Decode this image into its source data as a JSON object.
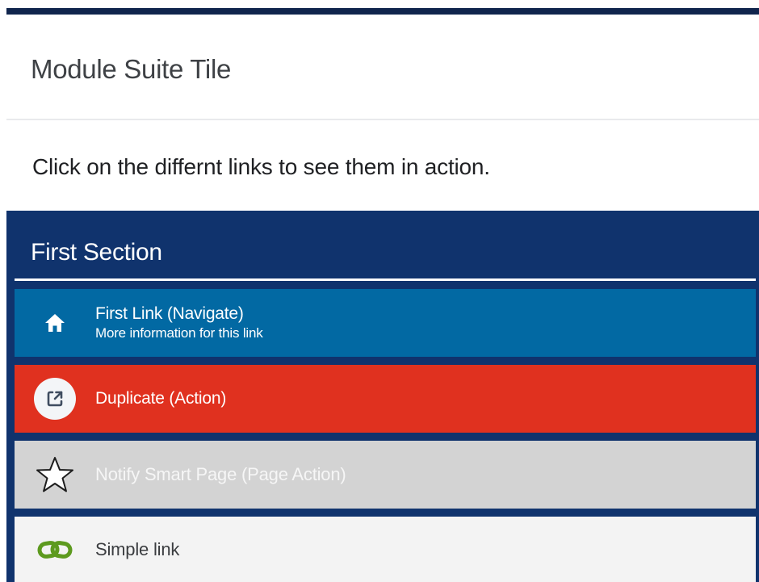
{
  "header": {
    "title": "Module Suite Tile"
  },
  "description": "Click on the differnt links to see them in action.",
  "section": {
    "title": "First Section",
    "links": [
      {
        "label": "First Link (Navigate)",
        "sublabel": "More information for this link",
        "icon": "home-icon",
        "color": "#0269a3"
      },
      {
        "label": "Duplicate (Action)",
        "icon": "external-link-icon",
        "color": "#e0311f"
      },
      {
        "label": "Notify Smart Page (Page Action)",
        "icon": "star-icon",
        "color": "#d3d3d3"
      },
      {
        "label": "Simple link",
        "icon": "chain-link-icon",
        "color": "#f3f3f3"
      }
    ]
  },
  "colors": {
    "top_bar": "#10254d",
    "section_background": "#10336d",
    "link_icon_green": "#5d9a1f"
  }
}
